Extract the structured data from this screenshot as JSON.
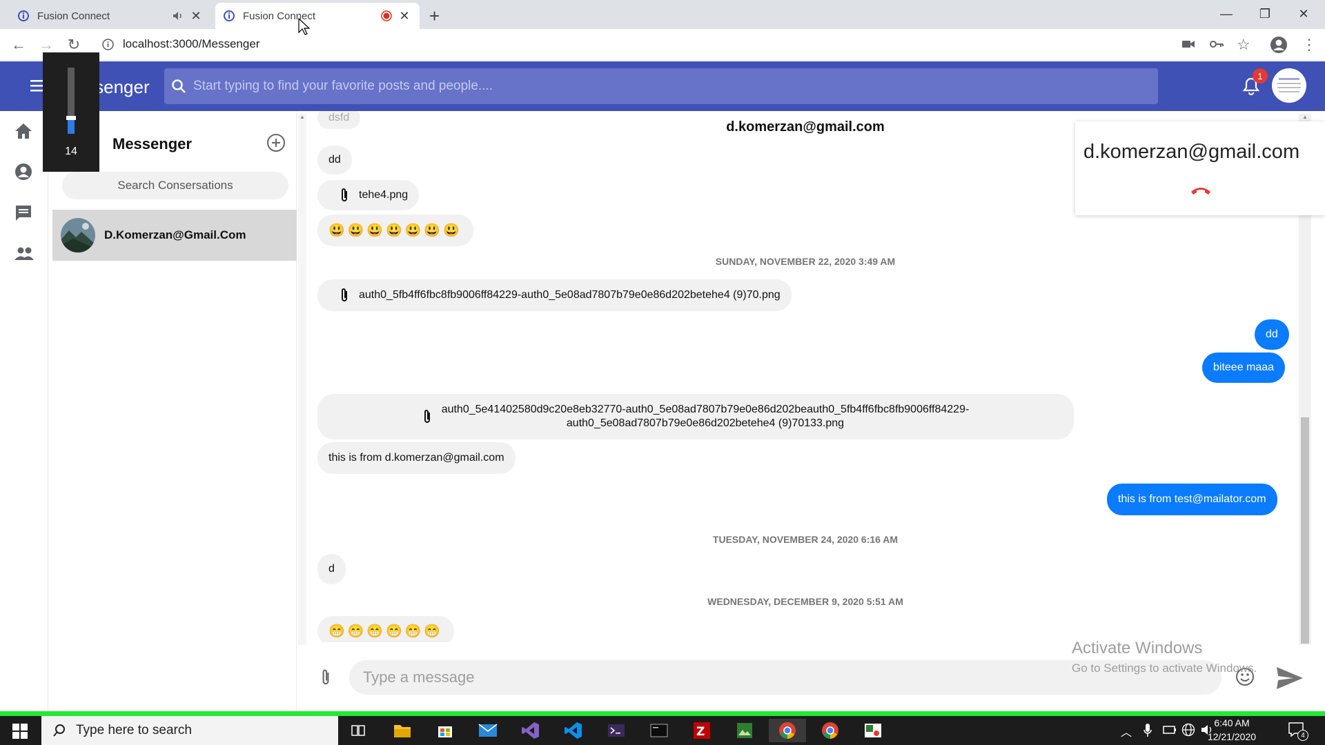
{
  "browser": {
    "tabs": [
      {
        "title": "Fusion Connect",
        "active": false,
        "audio": true
      },
      {
        "title": "Fusion Connect",
        "active": true,
        "recording": true
      }
    ],
    "url": "localhost:3000/Messenger"
  },
  "appbar": {
    "title": "Messenger",
    "search_placeholder": "Start typing to find your favorite posts and people....",
    "notification_count": "1",
    "accent": "#3f51b5"
  },
  "volume_overlay": {
    "level": "14"
  },
  "conversations": {
    "title": "Messenger",
    "search_label": "Search Consersations",
    "items": [
      {
        "name": "D.Komerzan@Gmail.Com"
      }
    ]
  },
  "chat": {
    "header": "d.komerzan@gmail.com",
    "messages": {
      "top_partial": "dsfd",
      "m1": "dd",
      "file1": "tehe4.png",
      "sep1": "SUNDAY, NOVEMBER 22, 2020 3:49 AM",
      "file2": "auth0_5fb4ff6fbc8fb9006ff84229-auth0_5e08ad7807b79e0e86d202betehe4 (9)70.png",
      "out1": "dd",
      "out2": "biteee maaa",
      "file3_line1": "auth0_5e41402580d9c20e8eb32770-auth0_5e08ad7807b79e0e86d202beauth0_5fb4ff6fbc8fb9006ff84229-",
      "file3_line2": "auth0_5e08ad7807b79e0e86d202betehe4 (9)70133.png",
      "m2": "this is from d.komerzan@gmail.com",
      "out3": "this is from test@mailator.com",
      "sep2": "TUESDAY, NOVEMBER 24, 2020 6:16 AM",
      "m3": "d",
      "sep3": "WEDNESDAY, DECEMBER 9, 2020 5:51 AM"
    },
    "outgoing_color": "#0b7bff"
  },
  "call_popup": {
    "email": "d.komerzan@gmail.com"
  },
  "composer": {
    "placeholder": "Type a message"
  },
  "watermark": {
    "line1": "Activate Windows",
    "line2": "Go to Settings to activate Windows."
  },
  "taskbar": {
    "search_placeholder": "Type here to search",
    "time": "6:40 AM",
    "date": "12/21/2020",
    "notification_count": "4"
  }
}
